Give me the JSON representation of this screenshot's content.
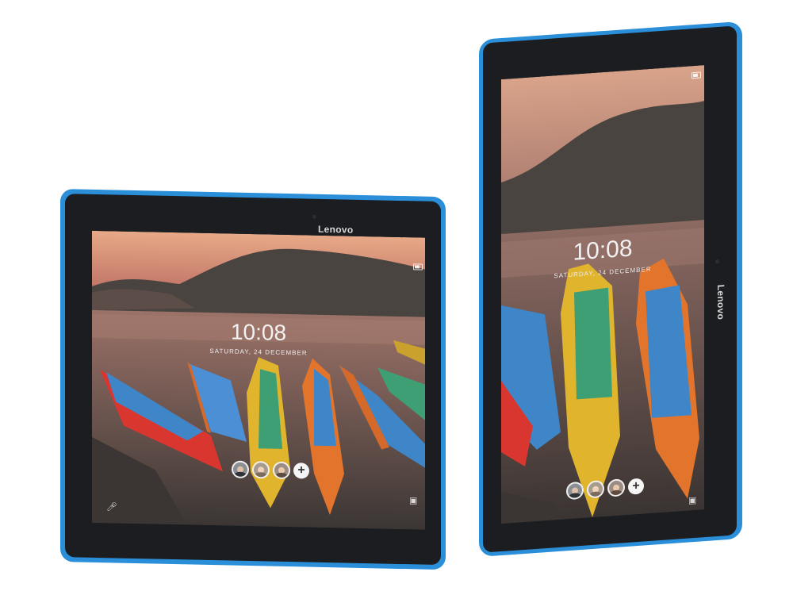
{
  "brand": "Lenovo",
  "lock_screen": {
    "time": "10:08",
    "date": "SATURDAY, 24 DECEMBER"
  },
  "icons": {
    "voice": "microphone-icon",
    "camera": "camera-icon",
    "battery": "battery-icon",
    "add_user": "plus-icon"
  },
  "colors": {
    "frame_accent": "#2a8fd8",
    "bezel": "#1b1d21"
  }
}
